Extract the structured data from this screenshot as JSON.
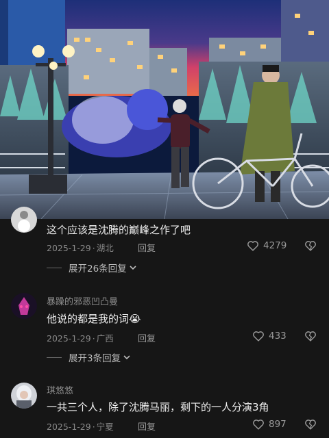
{
  "comments": [
    {
      "username": "",
      "text": "这个应该是沈腾的巅峰之作了吧",
      "date": "2025-1-29",
      "location": "湖北",
      "reply_label": "回复",
      "likes": "4279",
      "expand_label": "展开26条回复"
    },
    {
      "username": "暴躁的邪恶凹凸曼",
      "text": "他说的都是我的词",
      "emoji": "😭",
      "date": "2025-1-29",
      "location": "广西",
      "reply_label": "回复",
      "likes": "433",
      "expand_label": "展开3条回复"
    },
    {
      "username": "琪悠悠",
      "text": "一共三个人，除了沈腾马丽，剩下的一人分演3角",
      "date": "2025-1-29",
      "location": "宁夏",
      "reply_label": "回复",
      "likes": "897"
    }
  ],
  "icons": {
    "like": "heart-outline-icon",
    "dislike": "broken-heart-icon",
    "expand": "chevron-down-icon"
  },
  "colors": {
    "background": "#161616",
    "text_primary": "#f0f0f0",
    "text_secondary": "#8a8a8a"
  }
}
